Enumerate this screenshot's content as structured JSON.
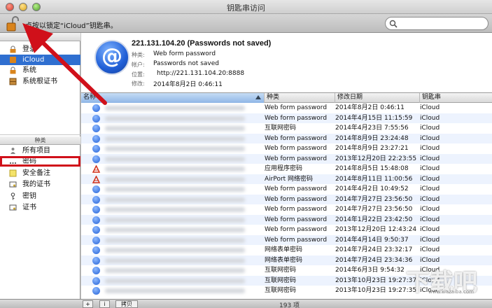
{
  "window": {
    "title": "钥匙串访问"
  },
  "toolbar": {
    "lock_hint": "点按以锁定“iCloud”钥匙串。"
  },
  "sidebar": {
    "keychains_header": "钥匙串",
    "keychains": [
      {
        "label": "登录",
        "icon": "lock-icon"
      },
      {
        "label": "iCloud",
        "icon": "cloud-icon",
        "selected": true
      },
      {
        "label": "系统",
        "icon": "lock-icon"
      },
      {
        "label": "系统根证书",
        "icon": "cabinet-icon"
      }
    ],
    "category_header": "种类",
    "categories": [
      {
        "label": "所有项目",
        "icon": "people-icon"
      },
      {
        "label": "密码",
        "icon": "password-dots-icon",
        "highlighted": true
      },
      {
        "label": "安全备注",
        "icon": "note-icon"
      },
      {
        "label": "我的证书",
        "icon": "certificate-icon"
      },
      {
        "label": "密钥",
        "icon": "key-icon"
      },
      {
        "label": "证书",
        "icon": "certificate-icon"
      }
    ]
  },
  "detail": {
    "title": "221.131.104.20 (Passwords not saved)",
    "kind_label": "种类:",
    "kind_value": "Web form password",
    "account_label": "帐户:",
    "account_value": "Passwords not saved",
    "where_label": "位置:",
    "where_value": "http://221.131.104.20:8888",
    "modified_label": "修改:",
    "modified_value": "2014年8月2日 0:46:11"
  },
  "table": {
    "columns": [
      "名称",
      "种类",
      "修改日期",
      "钥匙串"
    ],
    "rows": [
      {
        "icon": "web",
        "kind": "Web form password",
        "date": "2014年8月2日 0:46:11",
        "chain": "iCloud"
      },
      {
        "icon": "web",
        "kind": "Web form password",
        "date": "2014年4月15日 11:15:59",
        "chain": "iCloud"
      },
      {
        "icon": "web",
        "kind": "互联网密码",
        "date": "2014年4月23日 7:55:56",
        "chain": "iCloud"
      },
      {
        "icon": "web",
        "kind": "Web form password",
        "date": "2014年8月9日 23:24:48",
        "chain": "iCloud"
      },
      {
        "icon": "web",
        "kind": "Web form password",
        "date": "2014年8月9日 23:27:21",
        "chain": "iCloud"
      },
      {
        "icon": "web",
        "kind": "Web form password",
        "date": "2013年12月20日 22:23:55",
        "chain": "iCloud"
      },
      {
        "icon": "app",
        "kind": "应用程序密码",
        "date": "2014年8月5日 15:48:08",
        "chain": "iCloud"
      },
      {
        "icon": "app",
        "kind": "AirPort 网络密码",
        "date": "2014年8月11日 11:00:56",
        "chain": "iCloud"
      },
      {
        "icon": "web",
        "kind": "Web form password",
        "date": "2014年4月2日 10:49:52",
        "chain": "iCloud"
      },
      {
        "icon": "web",
        "kind": "Web form password",
        "date": "2014年7月27日 23:56:50",
        "chain": "iCloud"
      },
      {
        "icon": "web",
        "kind": "Web form password",
        "date": "2014年7月27日 23:56:50",
        "chain": "iCloud"
      },
      {
        "icon": "web",
        "kind": "Web form password",
        "date": "2014年1月22日 23:42:50",
        "chain": "iCloud"
      },
      {
        "icon": "web",
        "kind": "Web form password",
        "date": "2013年12月20日 12:43:24",
        "chain": "iCloud"
      },
      {
        "icon": "web",
        "kind": "Web form password",
        "date": "2014年4月14日 9:50:37",
        "chain": "iCloud"
      },
      {
        "icon": "web",
        "kind": "网络表单密码",
        "date": "2014年7月24日 23:32:17",
        "chain": "iCloud"
      },
      {
        "icon": "web",
        "kind": "网络表单密码",
        "date": "2014年7月24日 23:34:36",
        "chain": "iCloud"
      },
      {
        "icon": "web",
        "kind": "互联网密码",
        "date": "2014年6月3日 9:54:32",
        "chain": "iCloud"
      },
      {
        "icon": "web",
        "kind": "互联网密码",
        "date": "2013年10月23日 19:27:37",
        "chain": "iCloud"
      },
      {
        "icon": "web",
        "kind": "互联网密码",
        "date": "2013年10月23日 19:27:35",
        "chain": "iCloud"
      }
    ]
  },
  "bottombar": {
    "add": "+",
    "info": "i",
    "copy": "拷贝",
    "count": "193 项"
  },
  "watermark": {
    "main": "下载吧",
    "sub": "www.xiazaiba.com"
  },
  "colors": {
    "selection": "#2f6fd0",
    "annotation_red": "#d0101a",
    "row_alt": "#edf3fe"
  }
}
